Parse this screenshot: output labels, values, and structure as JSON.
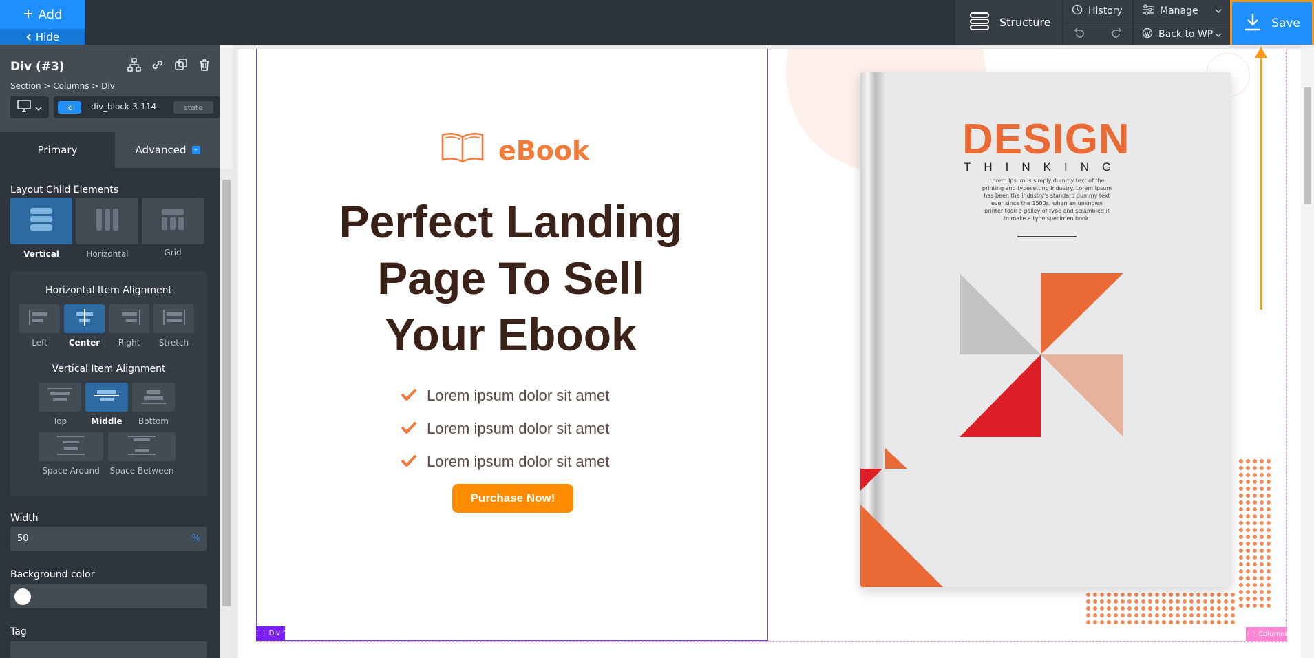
{
  "topbar": {
    "add_label": "Add",
    "hide_label": "Hide",
    "structure_label": "Structure",
    "history_label": "History",
    "manage_label": "Manage",
    "back_label": "Back to WP",
    "save_label": "Save"
  },
  "panel": {
    "element_title": "Div (#3)",
    "breadcrumb": "Section > Columns > Div",
    "id_badge": "id",
    "id_value": "div_block-3-114",
    "state_label": "state",
    "tabs": {
      "primary": "Primary",
      "advanced": "Advanced"
    },
    "layout_title": "Layout Child Elements",
    "layout_options": [
      {
        "label": "Vertical"
      },
      {
        "label": "Horizontal"
      },
      {
        "label": "Grid"
      }
    ],
    "h_align_title": "Horizontal Item Alignment",
    "h_align": [
      "Left",
      "Center",
      "Right",
      "Stretch"
    ],
    "v_align_title": "Vertical Item Alignment",
    "v_align": [
      "Top",
      "Middle",
      "Bottom"
    ],
    "v_space": [
      "Space Around",
      "Space Between"
    ],
    "width_label": "Width",
    "width_value": "50",
    "width_unit": "%",
    "bg_label": "Background color",
    "tag_label": "Tag"
  },
  "canvas": {
    "brand": "eBook",
    "headline_lines": [
      "Perfect Landing",
      "Page To Sell",
      "Your Ebook"
    ],
    "features": [
      "Lorem ipsum dolor sit amet",
      "Lorem ipsum dolor sit amet",
      "Lorem ipsum dolor sit amet"
    ],
    "cta": "Purchase Now!",
    "div_tag": "Div",
    "columns_tag": "Columns",
    "book": {
      "title": "DESIGN",
      "subtitle": "THINKING",
      "blurb": "Lorem Ipsum is simply dummy text of the printing and typesetting industry. Lorem Ipsum has been the industry's standard dummy text ever since the 1500s, when an unknown printer took a galley of type and scrambled it to make a type specimen book."
    }
  },
  "colors": {
    "accent": "#1e90ff",
    "highlight": "#ff9a18",
    "brand_orange": "#f27b3a",
    "headline": "#3b2219"
  }
}
